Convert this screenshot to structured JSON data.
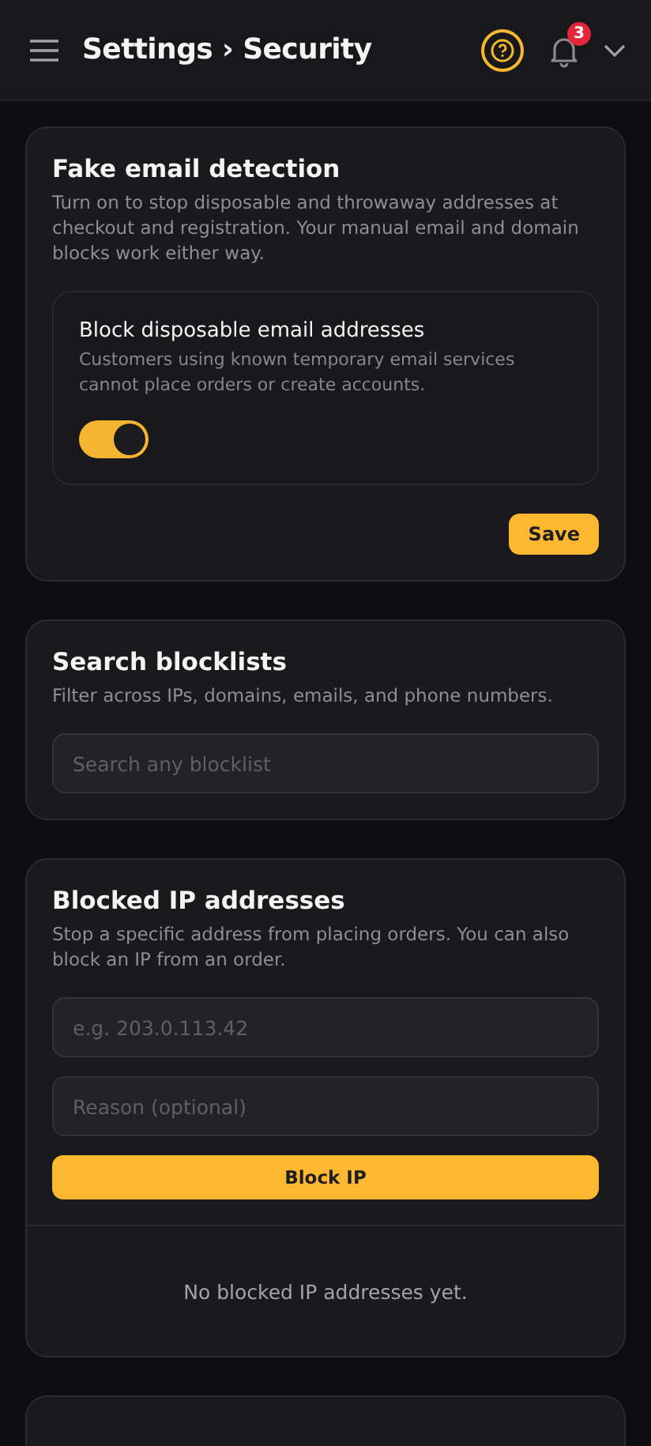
{
  "header": {
    "title": "Settings › Security",
    "notification_count": "3"
  },
  "sections": [
    {
      "kind": "toggle",
      "title": "Fake email detection",
      "description": "Turn on to stop disposable and throwaway addresses at checkout and registration. Your manual email and domain blocks work either way.",
      "setting": {
        "label": "Block disposable email addresses",
        "description": "Customers using known temporary email services cannot place orders or create accounts.",
        "on": true
      },
      "button": "Save"
    },
    {
      "kind": "search",
      "title": "Search blocklists",
      "description": "Filter across IPs, domains, emails, and phone numbers.",
      "fields": [
        {
          "placeholder": "Search any blocklist"
        }
      ]
    },
    {
      "kind": "form",
      "title": "Blocked IP addresses",
      "description": "Stop a specific address from placing orders. You can also block an IP from an order.",
      "fields": [
        {
          "placeholder": "e.g. 203.0.113.42"
        },
        {
          "placeholder": "Reason (optional)"
        }
      ],
      "button": "Block IP",
      "empty_text": "No blocked IP addresses yet."
    }
  ]
}
